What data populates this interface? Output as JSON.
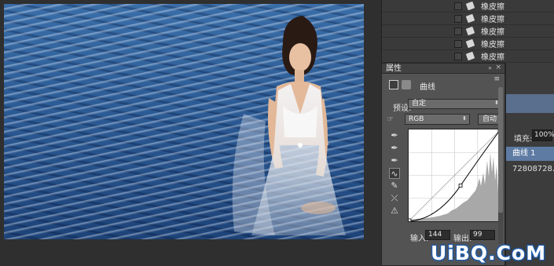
{
  "layers_panel": {
    "items": [
      {
        "label": "橡皮擦"
      },
      {
        "label": "橡皮擦"
      },
      {
        "label": "橡皮擦"
      },
      {
        "label": "橡皮擦"
      },
      {
        "label": "橡皮擦"
      }
    ]
  },
  "right_dock": {
    "fill_label": "填充:",
    "fill_value": "100%",
    "curves_layer": "曲线 1",
    "layer_code": "72808728..."
  },
  "properties": {
    "title": "属性",
    "adjustment_name": "曲线",
    "preset_label": "预设:",
    "preset_value": "自定",
    "channel_value": "RGB",
    "auto_label": "自动",
    "input_label": "输入:",
    "input_value": "144",
    "output_label": "输出:",
    "output_value": "99",
    "curve_point": {
      "input": 144,
      "output": 99
    }
  },
  "icons": {
    "panel_collapse": "»",
    "panel_close": "×",
    "panel_menu": "≡",
    "select_arrows": "⬍",
    "hand": "☞",
    "eyedropper": "✒",
    "curve_tool": "∿",
    "pencil": "✎",
    "smooth": "⤫",
    "clip_warning": "⚠"
  },
  "watermark": "UiBQ.CoM",
  "colors": {
    "panel_bg": "#535353",
    "selection_blue": "#5d7ba3",
    "watermark_outline": "#1c5cb0"
  }
}
